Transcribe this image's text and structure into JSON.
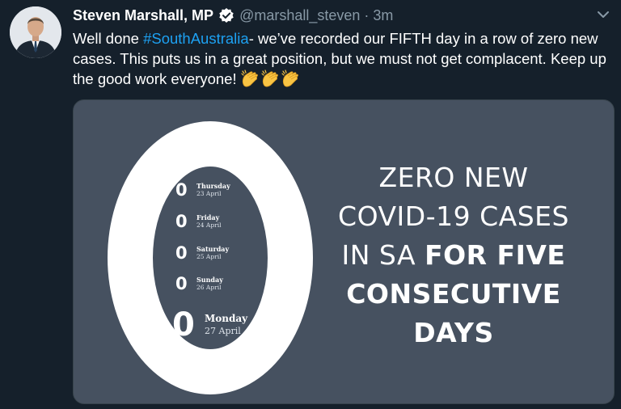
{
  "tweet": {
    "author_name": "Steven Marshall, MP",
    "handle": "@marshall_steven",
    "separator": "·",
    "time": "3m",
    "text_before_hashtag": "Well done ",
    "hashtag": "#SouthAustralia",
    "text_after_hashtag": "- we’ve recorded our FIFTH day in a row of zero new cases. This puts us in a great position, but we must not get complacent. Keep up the good work everyone!",
    "emojis": [
      "clapping-hands",
      "clapping-hands",
      "clapping-hands"
    ]
  },
  "card": {
    "days": [
      {
        "count": "0",
        "day": "Thursday",
        "date": "23 April"
      },
      {
        "count": "0",
        "day": "Friday",
        "date": "24 April"
      },
      {
        "count": "0",
        "day": "Saturday",
        "date": "25 April"
      },
      {
        "count": "0",
        "day": "Sunday",
        "date": "26 April"
      },
      {
        "count": "0",
        "day": "Monday",
        "date": "27 April"
      }
    ],
    "headline": {
      "line1": "ZERO NEW",
      "line2": "COVID-19 CASES",
      "line3_light": "IN SA ",
      "line3_bold": "FOR FIVE",
      "line4": "CONSECUTIVE",
      "line5": "DAYS"
    }
  },
  "colors": {
    "background": "#15202b",
    "link": "#1da1f2",
    "muted": "#8899a6",
    "card_bg": "#465160"
  }
}
